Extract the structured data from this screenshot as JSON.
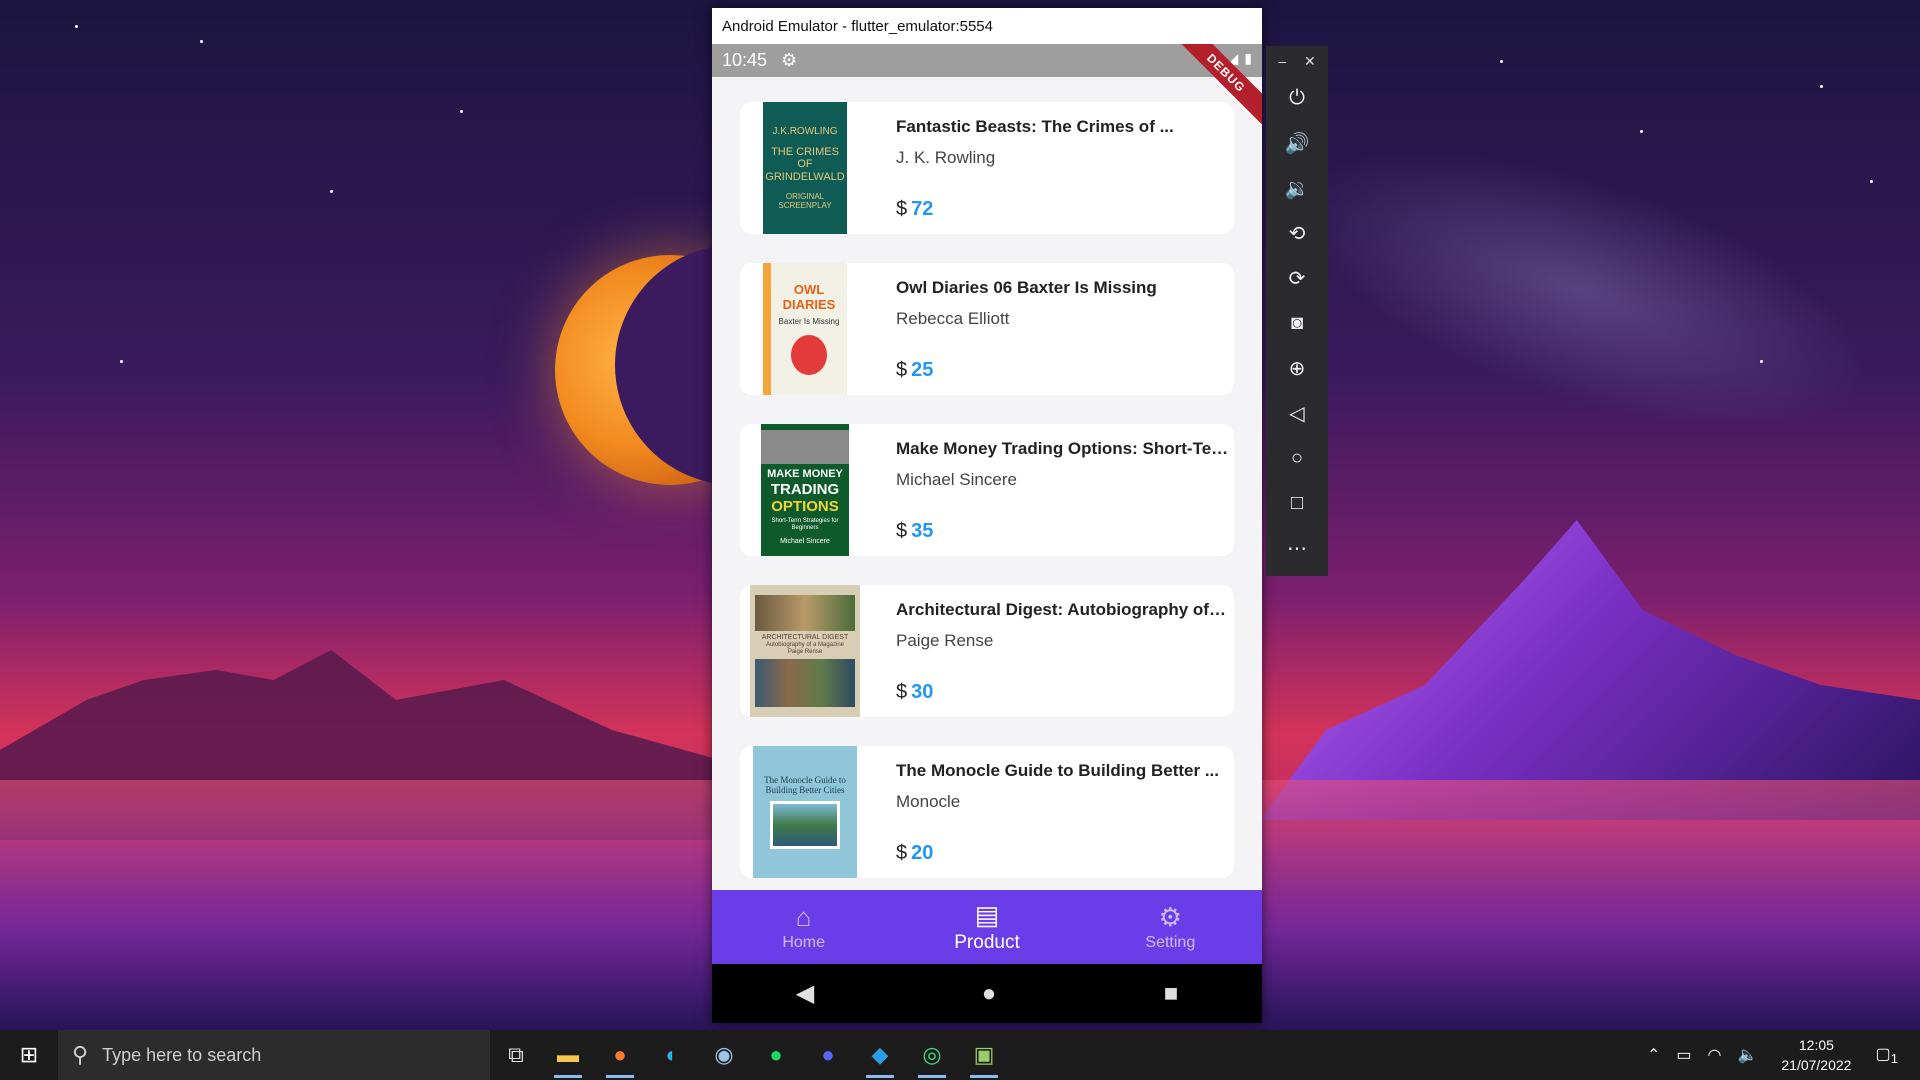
{
  "emulator": {
    "window_title": "Android Emulator - flutter_emulator:5554",
    "status_time": "10:45",
    "debug_ribbon": "DEBUG"
  },
  "books": [
    {
      "title": "Fantastic Beasts: The Crimes of ...",
      "author": "J. K. Rowling",
      "currency": "$",
      "price": "72",
      "cover_lines": [
        "J.K.ROWLING",
        "THE CRIMES OF GRINDELWALD",
        "ORIGINAL SCREENPLAY"
      ],
      "cover_color": "#0f5c57"
    },
    {
      "title": "Owl Diaries 06 Baxter Is Missing",
      "author": "Rebecca Elliott",
      "currency": "$",
      "price": "25",
      "cover_lines": [
        "OWL DIARIES",
        "Baxter Is Missing"
      ],
      "cover_color": "#f3f0e6"
    },
    {
      "title": "Make Money Trading Options: Short-Ter...",
      "author": "Michael Sincere",
      "currency": "$",
      "price": "35",
      "cover_lines": [
        "MAKE MONEY",
        "TRADING",
        "OPTIONS",
        "Short-Term Strategies for Beginners",
        "Michael Sincere"
      ],
      "cover_color": "#0e5a2a"
    },
    {
      "title": "Architectural Digest: Autobiography of a ...",
      "author": "Paige Rense",
      "currency": "$",
      "price": "30",
      "cover_lines": [
        "ARCHITECTURAL DIGEST",
        "Autobiography of a Magazine",
        "Paige Rense"
      ],
      "cover_color": "#d8cdb5"
    },
    {
      "title": "The Monocle Guide to Building Better ...",
      "author": "Monocle",
      "currency": "$",
      "price": "20",
      "cover_lines": [
        "The Monocle Guide to Building Better Cities"
      ],
      "cover_color": "#8fc6da"
    }
  ],
  "bottom_nav": {
    "items": [
      {
        "label": "Home",
        "icon": "home-icon"
      },
      {
        "label": "Product",
        "icon": "book-icon"
      },
      {
        "label": "Setting",
        "icon": "gear-icon"
      }
    ],
    "active": "Product"
  },
  "taskbar": {
    "search_placeholder": "Type here to search",
    "time": "12:05",
    "date": "21/07/2022",
    "notification_count": "1"
  },
  "colors": {
    "accent": "#6a3de8",
    "price": "#2196f3"
  }
}
